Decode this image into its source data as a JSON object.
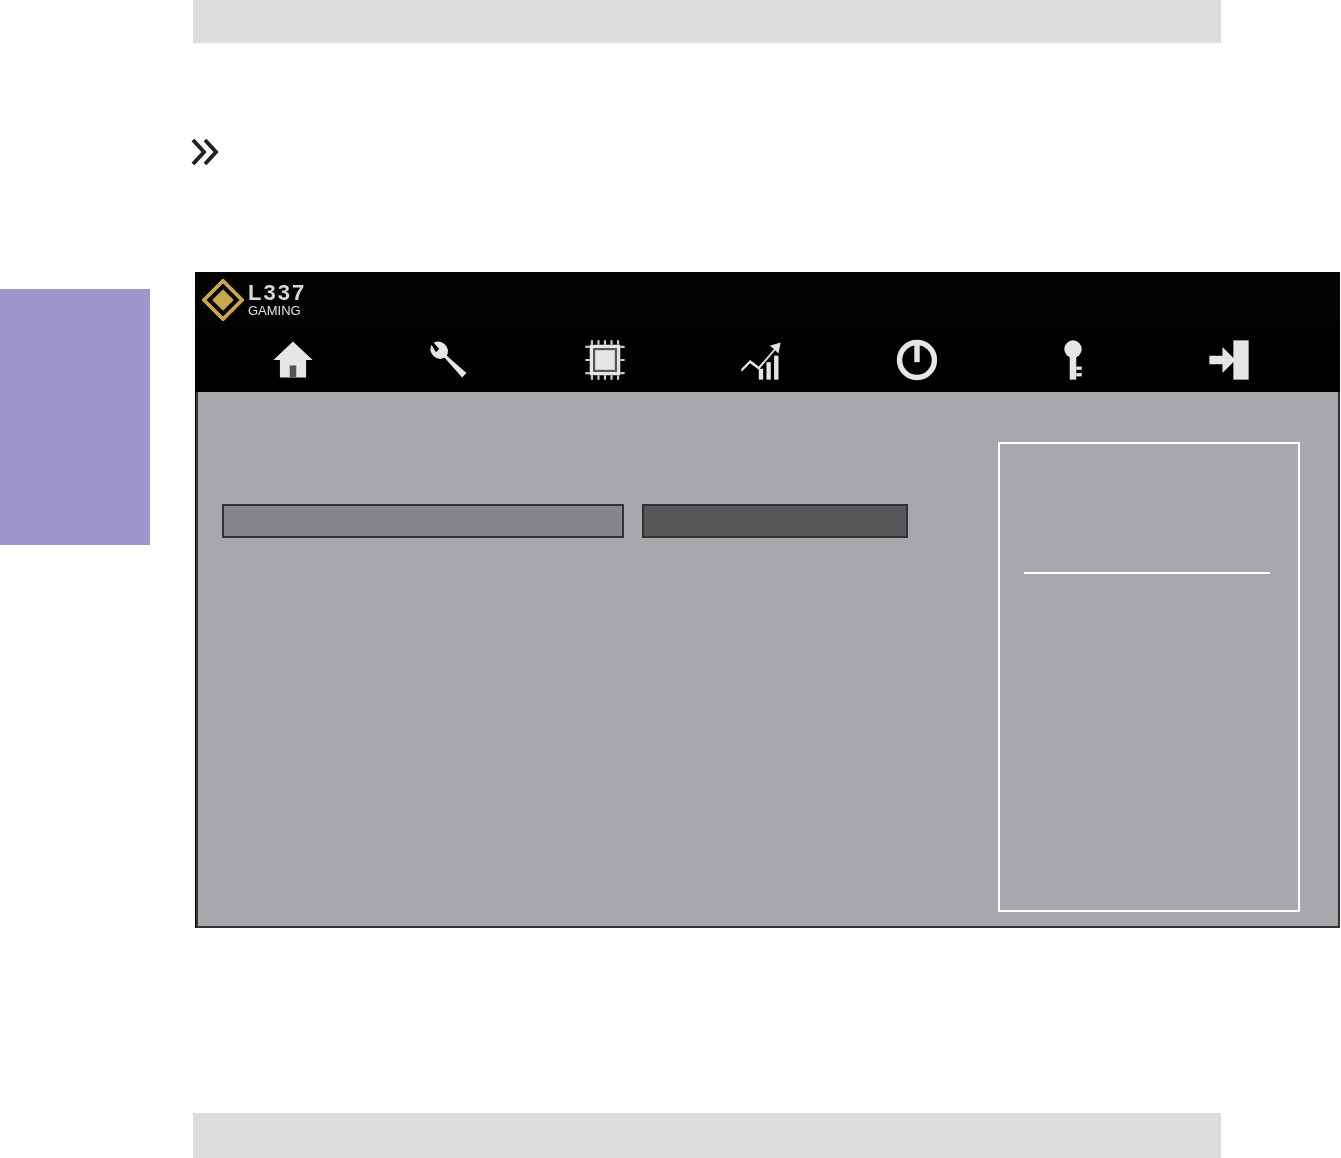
{
  "logo": {
    "text": "L337",
    "subtitle": "GAMING"
  },
  "nav": [
    {
      "kind": "home"
    },
    {
      "kind": "tools"
    },
    {
      "kind": "chip"
    },
    {
      "kind": "chart"
    },
    {
      "kind": "power"
    },
    {
      "kind": "key"
    },
    {
      "kind": "exit"
    }
  ]
}
